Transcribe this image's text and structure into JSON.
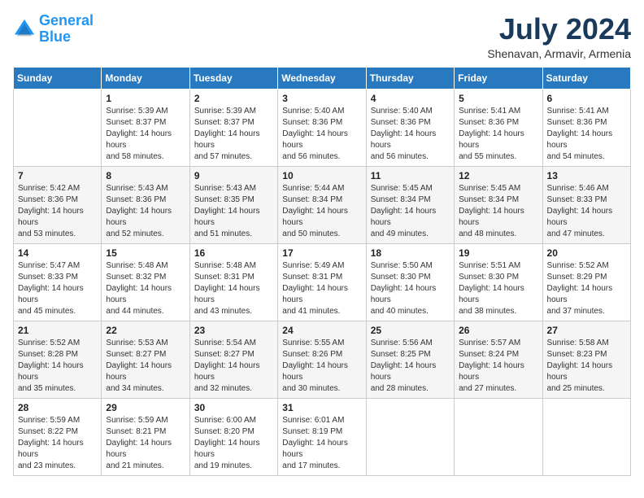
{
  "header": {
    "logo": {
      "line1": "General",
      "line2": "Blue"
    },
    "title": "July 2024",
    "location": "Shenavan, Armavir, Armenia"
  },
  "weekdays": [
    "Sunday",
    "Monday",
    "Tuesday",
    "Wednesday",
    "Thursday",
    "Friday",
    "Saturday"
  ],
  "weeks": [
    [
      {
        "day": "",
        "sunrise": "",
        "sunset": "",
        "daylight": ""
      },
      {
        "day": "1",
        "sunrise": "Sunrise: 5:39 AM",
        "sunset": "Sunset: 8:37 PM",
        "daylight": "Daylight: 14 hours and 58 minutes."
      },
      {
        "day": "2",
        "sunrise": "Sunrise: 5:39 AM",
        "sunset": "Sunset: 8:37 PM",
        "daylight": "Daylight: 14 hours and 57 minutes."
      },
      {
        "day": "3",
        "sunrise": "Sunrise: 5:40 AM",
        "sunset": "Sunset: 8:36 PM",
        "daylight": "Daylight: 14 hours and 56 minutes."
      },
      {
        "day": "4",
        "sunrise": "Sunrise: 5:40 AM",
        "sunset": "Sunset: 8:36 PM",
        "daylight": "Daylight: 14 hours and 56 minutes."
      },
      {
        "day": "5",
        "sunrise": "Sunrise: 5:41 AM",
        "sunset": "Sunset: 8:36 PM",
        "daylight": "Daylight: 14 hours and 55 minutes."
      },
      {
        "day": "6",
        "sunrise": "Sunrise: 5:41 AM",
        "sunset": "Sunset: 8:36 PM",
        "daylight": "Daylight: 14 hours and 54 minutes."
      }
    ],
    [
      {
        "day": "7",
        "sunrise": "Sunrise: 5:42 AM",
        "sunset": "Sunset: 8:36 PM",
        "daylight": "Daylight: 14 hours and 53 minutes."
      },
      {
        "day": "8",
        "sunrise": "Sunrise: 5:43 AM",
        "sunset": "Sunset: 8:36 PM",
        "daylight": "Daylight: 14 hours and 52 minutes."
      },
      {
        "day": "9",
        "sunrise": "Sunrise: 5:43 AM",
        "sunset": "Sunset: 8:35 PM",
        "daylight": "Daylight: 14 hours and 51 minutes."
      },
      {
        "day": "10",
        "sunrise": "Sunrise: 5:44 AM",
        "sunset": "Sunset: 8:34 PM",
        "daylight": "Daylight: 14 hours and 50 minutes."
      },
      {
        "day": "11",
        "sunrise": "Sunrise: 5:45 AM",
        "sunset": "Sunset: 8:34 PM",
        "daylight": "Daylight: 14 hours and 49 minutes."
      },
      {
        "day": "12",
        "sunrise": "Sunrise: 5:45 AM",
        "sunset": "Sunset: 8:34 PM",
        "daylight": "Daylight: 14 hours and 48 minutes."
      },
      {
        "day": "13",
        "sunrise": "Sunrise: 5:46 AM",
        "sunset": "Sunset: 8:33 PM",
        "daylight": "Daylight: 14 hours and 47 minutes."
      }
    ],
    [
      {
        "day": "14",
        "sunrise": "Sunrise: 5:47 AM",
        "sunset": "Sunset: 8:33 PM",
        "daylight": "Daylight: 14 hours and 45 minutes."
      },
      {
        "day": "15",
        "sunrise": "Sunrise: 5:48 AM",
        "sunset": "Sunset: 8:32 PM",
        "daylight": "Daylight: 14 hours and 44 minutes."
      },
      {
        "day": "16",
        "sunrise": "Sunrise: 5:48 AM",
        "sunset": "Sunset: 8:31 PM",
        "daylight": "Daylight: 14 hours and 43 minutes."
      },
      {
        "day": "17",
        "sunrise": "Sunrise: 5:49 AM",
        "sunset": "Sunset: 8:31 PM",
        "daylight": "Daylight: 14 hours and 41 minutes."
      },
      {
        "day": "18",
        "sunrise": "Sunrise: 5:50 AM",
        "sunset": "Sunset: 8:30 PM",
        "daylight": "Daylight: 14 hours and 40 minutes."
      },
      {
        "day": "19",
        "sunrise": "Sunrise: 5:51 AM",
        "sunset": "Sunset: 8:30 PM",
        "daylight": "Daylight: 14 hours and 38 minutes."
      },
      {
        "day": "20",
        "sunrise": "Sunrise: 5:52 AM",
        "sunset": "Sunset: 8:29 PM",
        "daylight": "Daylight: 14 hours and 37 minutes."
      }
    ],
    [
      {
        "day": "21",
        "sunrise": "Sunrise: 5:52 AM",
        "sunset": "Sunset: 8:28 PM",
        "daylight": "Daylight: 14 hours and 35 minutes."
      },
      {
        "day": "22",
        "sunrise": "Sunrise: 5:53 AM",
        "sunset": "Sunset: 8:27 PM",
        "daylight": "Daylight: 14 hours and 34 minutes."
      },
      {
        "day": "23",
        "sunrise": "Sunrise: 5:54 AM",
        "sunset": "Sunset: 8:27 PM",
        "daylight": "Daylight: 14 hours and 32 minutes."
      },
      {
        "day": "24",
        "sunrise": "Sunrise: 5:55 AM",
        "sunset": "Sunset: 8:26 PM",
        "daylight": "Daylight: 14 hours and 30 minutes."
      },
      {
        "day": "25",
        "sunrise": "Sunrise: 5:56 AM",
        "sunset": "Sunset: 8:25 PM",
        "daylight": "Daylight: 14 hours and 28 minutes."
      },
      {
        "day": "26",
        "sunrise": "Sunrise: 5:57 AM",
        "sunset": "Sunset: 8:24 PM",
        "daylight": "Daylight: 14 hours and 27 minutes."
      },
      {
        "day": "27",
        "sunrise": "Sunrise: 5:58 AM",
        "sunset": "Sunset: 8:23 PM",
        "daylight": "Daylight: 14 hours and 25 minutes."
      }
    ],
    [
      {
        "day": "28",
        "sunrise": "Sunrise: 5:59 AM",
        "sunset": "Sunset: 8:22 PM",
        "daylight": "Daylight: 14 hours and 23 minutes."
      },
      {
        "day": "29",
        "sunrise": "Sunrise: 5:59 AM",
        "sunset": "Sunset: 8:21 PM",
        "daylight": "Daylight: 14 hours and 21 minutes."
      },
      {
        "day": "30",
        "sunrise": "Sunrise: 6:00 AM",
        "sunset": "Sunset: 8:20 PM",
        "daylight": "Daylight: 14 hours and 19 minutes."
      },
      {
        "day": "31",
        "sunrise": "Sunrise: 6:01 AM",
        "sunset": "Sunset: 8:19 PM",
        "daylight": "Daylight: 14 hours and 17 minutes."
      },
      {
        "day": "",
        "sunrise": "",
        "sunset": "",
        "daylight": ""
      },
      {
        "day": "",
        "sunrise": "",
        "sunset": "",
        "daylight": ""
      },
      {
        "day": "",
        "sunrise": "",
        "sunset": "",
        "daylight": ""
      }
    ]
  ]
}
